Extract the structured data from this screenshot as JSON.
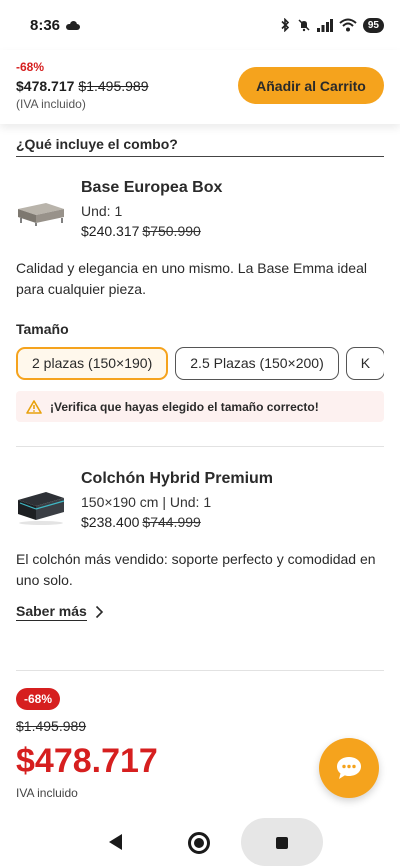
{
  "status_bar": {
    "time": "8:36",
    "battery": "95",
    "icons": [
      "cloud-icon",
      "bluetooth-icon",
      "mute-icon",
      "signal-icon",
      "wifi-icon",
      "battery-icon"
    ]
  },
  "sticky": {
    "discount": "-68%",
    "price": "$478.717",
    "old_price": "$1.495.989",
    "iva": "(IVA incluido)",
    "cart_label": "Añadir al Carrito"
  },
  "combo": {
    "heading": "¿Qué incluye el combo?"
  },
  "product1": {
    "title": "Base Europea Box",
    "meta": "Und: 1",
    "price": "$240.317",
    "old_price": "$750.990",
    "description": "Calidad y elegancia en uno mismo. La Base Emma ideal para cualquier pieza.",
    "size_label": "Tamaño",
    "sizes": [
      "2 plazas (150×190)",
      "2.5 Plazas (150×200)",
      "K"
    ],
    "selected_size": "2 plazas (150×190)",
    "warning": "¡Verifica que hayas elegido el tamaño correcto!"
  },
  "product2": {
    "title": "Colchón Hybrid Premium",
    "meta": "150×190 cm | Und: 1",
    "price": "$238.400",
    "old_price": "$744.999",
    "description": "El colchón más vendido: soporte perfecto y comodidad en uno solo.",
    "more_label": "Saber más"
  },
  "summary": {
    "badge": "-68%",
    "old_price": "$1.495.989",
    "price": "$478.717",
    "iva": "IVA incluido"
  },
  "colors": {
    "accent": "#f5a31d",
    "discount_red": "#d61f1f"
  }
}
